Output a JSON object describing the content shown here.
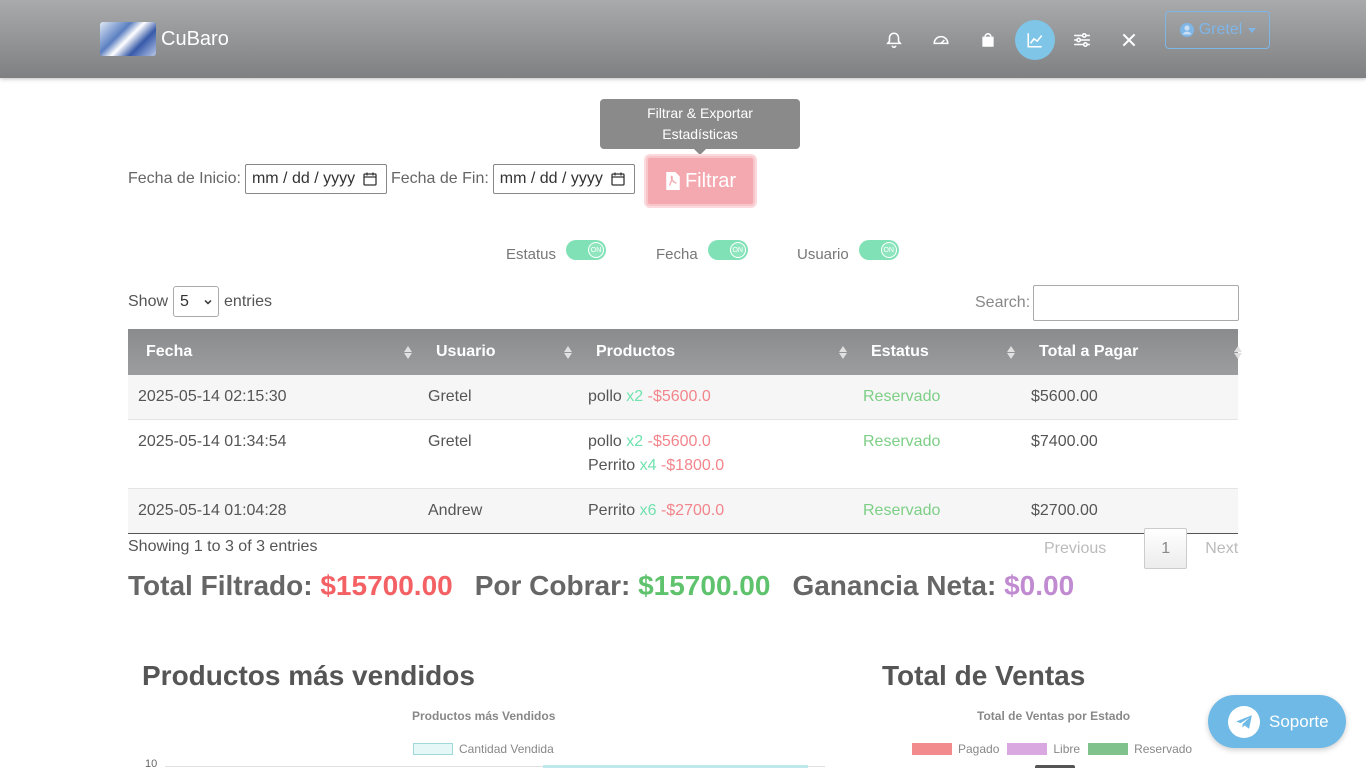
{
  "navbar": {
    "brand": "CuBaro",
    "icons": [
      "bell-icon",
      "speedometer-icon",
      "shopping-bag-icon",
      "chart-line-icon",
      "sliders-icon",
      "tools-icon"
    ],
    "active_icon": "chart-line-icon",
    "user": "Gretel"
  },
  "tooltip": {
    "line1": "Filtrar & Exportar",
    "line2": "Estadísticas"
  },
  "filter": {
    "start_label": "Fecha de Inicio:",
    "start_placeholder": "mm / dd / yyyy",
    "end_label": "Fecha de Fin:",
    "end_placeholder": "mm / dd / yyyy",
    "button": "Filtrar"
  },
  "toggles": [
    {
      "label": "Estatus",
      "state": "ON"
    },
    {
      "label": "Fecha",
      "state": "ON"
    },
    {
      "label": "Usuario",
      "state": "ON"
    }
  ],
  "table_controls": {
    "show": "Show",
    "entries_value": "5",
    "entries": "entries",
    "search": "Search:"
  },
  "table": {
    "columns": [
      "Fecha",
      "Usuario",
      "Productos",
      "Estatus",
      "Total a Pagar"
    ],
    "rows": [
      {
        "fecha": "2025-05-14 02:15:30",
        "usuario": "Gretel",
        "productos": [
          {
            "name": "pollo",
            "qty": "x2",
            "price": "-$5600.0"
          }
        ],
        "estatus": "Reservado",
        "total": "$5600.00"
      },
      {
        "fecha": "2025-05-14 01:34:54",
        "usuario": "Gretel",
        "productos": [
          {
            "name": "pollo",
            "qty": "x2",
            "price": "-$5600.0"
          },
          {
            "name": "Perrito",
            "qty": "x4",
            "price": "-$1800.0"
          }
        ],
        "estatus": "Reservado",
        "total": "$7400.00"
      },
      {
        "fecha": "2025-05-14 01:04:28",
        "usuario": "Andrew",
        "productos": [
          {
            "name": "Perrito",
            "qty": "x6",
            "price": "-$2700.0"
          }
        ],
        "estatus": "Reservado",
        "total": "$2700.00"
      }
    ]
  },
  "footer": {
    "info": "Showing 1 to 3 of 3 entries",
    "previous": "Previous",
    "page": "1",
    "next": "Next"
  },
  "totals": {
    "filtrado_label": "Total Filtrado:",
    "filtrado_value": "$15700.00",
    "cobrar_label": "Por Cobrar:",
    "cobrar_value": "$15700.00",
    "ganancia_label": "Ganancia Neta:",
    "ganancia_value": "$0.00"
  },
  "sections": {
    "left_title": "Productos más vendidos",
    "right_title": "Total de Ventas"
  },
  "chart_data": [
    {
      "type": "bar",
      "title": "Productos más Vendidos",
      "series": [
        {
          "name": "Cantidad Vendida",
          "color": "#e6f7f7"
        }
      ],
      "y_ticks_visible": [
        "10"
      ]
    },
    {
      "type": "pie",
      "title": "Total de Ventas por Estado",
      "series": [
        {
          "name": "Pagado",
          "color": "#f28b8b"
        },
        {
          "name": "Libre",
          "color": "#d9a8e0"
        },
        {
          "name": "Reservado",
          "color": "#7fc28c"
        }
      ]
    }
  ],
  "support": {
    "label": "Soporte"
  }
}
